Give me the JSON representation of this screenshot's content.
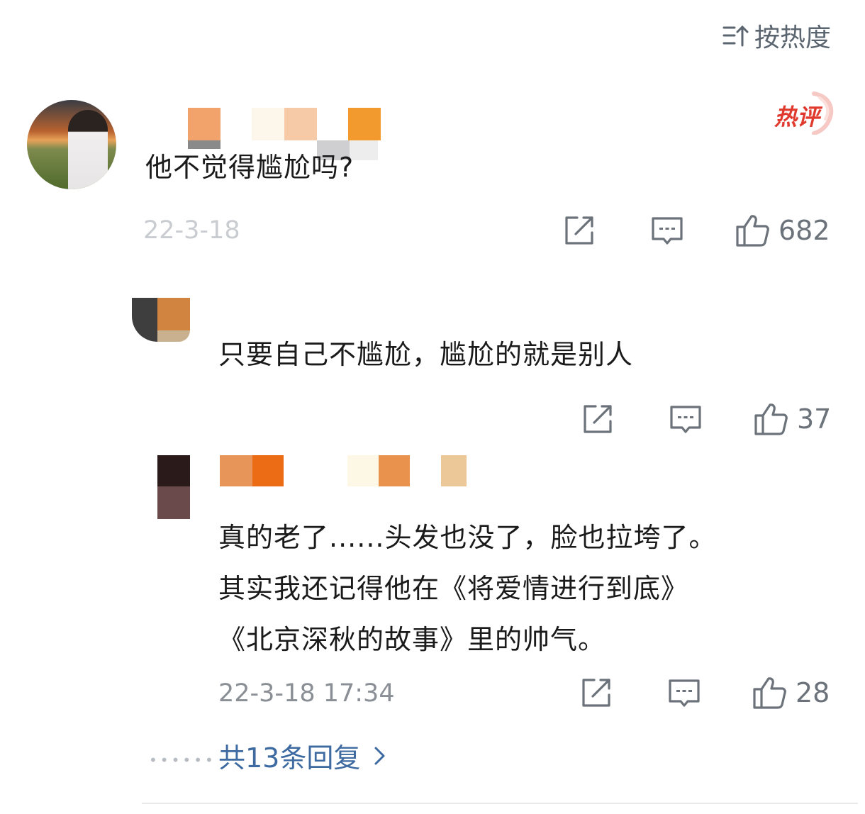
{
  "sort": {
    "label": "按热度"
  },
  "comments": [
    {
      "badge": "热评",
      "text": "他不觉得尴尬吗?",
      "time": "22-3-18",
      "likes": "682"
    },
    {
      "text": "只要自己不尴尬，尴尬的就是别人",
      "likes": "37"
    },
    {
      "text_lines": [
        "真的老了......头发也没了，脸也拉垮了。",
        "其实我还记得他在《将爱情进行到底》",
        "《北京深秋的故事》里的帅气。"
      ],
      "time": "22-3-18 17:34",
      "likes": "28"
    }
  ],
  "replies_link": {
    "label": "共13条回复"
  },
  "colors": {
    "link": "#3d6aa0",
    "meta": "#8a8f96",
    "icon": "#6c727a",
    "badge": "#e03a2f"
  }
}
